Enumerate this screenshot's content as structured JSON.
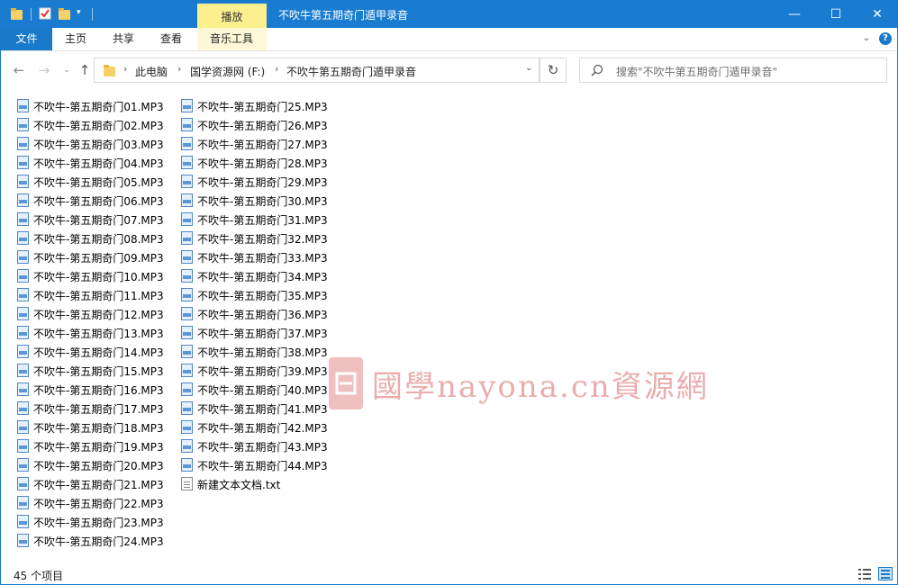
{
  "window": {
    "title": "不吹牛第五期奇门遁甲录音",
    "contextual_tab": "播放",
    "controls": {
      "minimize": "—",
      "maximize": "☐",
      "close": "✕"
    }
  },
  "ribbon": {
    "file_tab": "文件",
    "tabs": [
      "主页",
      "共享",
      "查看",
      "音乐工具"
    ]
  },
  "address": {
    "breadcrumbs": [
      "此电脑",
      "国学资源网 (F:)",
      "不吹牛第五期奇门遁甲录音"
    ],
    "separator": "›"
  },
  "search": {
    "placeholder": "搜索\"不吹牛第五期奇门遁甲录音\""
  },
  "files": [
    {
      "name": "不吹牛-第五期奇门01.MP3",
      "type": "mp3"
    },
    {
      "name": "不吹牛-第五期奇门02.MP3",
      "type": "mp3"
    },
    {
      "name": "不吹牛-第五期奇门03.MP3",
      "type": "mp3"
    },
    {
      "name": "不吹牛-第五期奇门04.MP3",
      "type": "mp3"
    },
    {
      "name": "不吹牛-第五期奇门05.MP3",
      "type": "mp3"
    },
    {
      "name": "不吹牛-第五期奇门06.MP3",
      "type": "mp3"
    },
    {
      "name": "不吹牛-第五期奇门07.MP3",
      "type": "mp3"
    },
    {
      "name": "不吹牛-第五期奇门08.MP3",
      "type": "mp3"
    },
    {
      "name": "不吹牛-第五期奇门09.MP3",
      "type": "mp3"
    },
    {
      "name": "不吹牛-第五期奇门10.MP3",
      "type": "mp3"
    },
    {
      "name": "不吹牛-第五期奇门11.MP3",
      "type": "mp3"
    },
    {
      "name": "不吹牛-第五期奇门12.MP3",
      "type": "mp3"
    },
    {
      "name": "不吹牛-第五期奇门13.MP3",
      "type": "mp3"
    },
    {
      "name": "不吹牛-第五期奇门14.MP3",
      "type": "mp3"
    },
    {
      "name": "不吹牛-第五期奇门15.MP3",
      "type": "mp3"
    },
    {
      "name": "不吹牛-第五期奇门16.MP3",
      "type": "mp3"
    },
    {
      "name": "不吹牛-第五期奇门17.MP3",
      "type": "mp3"
    },
    {
      "name": "不吹牛-第五期奇门18.MP3",
      "type": "mp3"
    },
    {
      "name": "不吹牛-第五期奇门19.MP3",
      "type": "mp3"
    },
    {
      "name": "不吹牛-第五期奇门20.MP3",
      "type": "mp3"
    },
    {
      "name": "不吹牛-第五期奇门21.MP3",
      "type": "mp3"
    },
    {
      "name": "不吹牛-第五期奇门22.MP3",
      "type": "mp3"
    },
    {
      "name": "不吹牛-第五期奇门23.MP3",
      "type": "mp3"
    },
    {
      "name": "不吹牛-第五期奇门24.MP3",
      "type": "mp3"
    },
    {
      "name": "不吹牛-第五期奇门25.MP3",
      "type": "mp3"
    },
    {
      "name": "不吹牛-第五期奇门26.MP3",
      "type": "mp3"
    },
    {
      "name": "不吹牛-第五期奇门27.MP3",
      "type": "mp3"
    },
    {
      "name": "不吹牛-第五期奇门28.MP3",
      "type": "mp3"
    },
    {
      "name": "不吹牛-第五期奇门29.MP3",
      "type": "mp3"
    },
    {
      "name": "不吹牛-第五期奇门30.MP3",
      "type": "mp3"
    },
    {
      "name": "不吹牛-第五期奇门31.MP3",
      "type": "mp3"
    },
    {
      "name": "不吹牛-第五期奇门32.MP3",
      "type": "mp3"
    },
    {
      "name": "不吹牛-第五期奇门33.MP3",
      "type": "mp3"
    },
    {
      "name": "不吹牛-第五期奇门34.MP3",
      "type": "mp3"
    },
    {
      "name": "不吹牛-第五期奇门35.MP3",
      "type": "mp3"
    },
    {
      "name": "不吹牛-第五期奇门36.MP3",
      "type": "mp3"
    },
    {
      "name": "不吹牛-第五期奇门37.MP3",
      "type": "mp3"
    },
    {
      "name": "不吹牛-第五期奇门38.MP3",
      "type": "mp3"
    },
    {
      "name": "不吹牛-第五期奇门39.MP3",
      "type": "mp3"
    },
    {
      "name": "不吹牛-第五期奇门40.MP3",
      "type": "mp3"
    },
    {
      "name": "不吹牛-第五期奇门41.MP3",
      "type": "mp3"
    },
    {
      "name": "不吹牛-第五期奇门42.MP3",
      "type": "mp3"
    },
    {
      "name": "不吹牛-第五期奇门43.MP3",
      "type": "mp3"
    },
    {
      "name": "不吹牛-第五期奇门44.MP3",
      "type": "mp3"
    },
    {
      "name": "新建文本文档.txt",
      "type": "txt"
    }
  ],
  "watermark": {
    "seal": "德",
    "text": "國學nayona.cn資源網"
  },
  "status": {
    "item_count": "45 个项目"
  },
  "colors": {
    "titlebar": "#1a7cd0",
    "contextual_tab": "#fbf08d",
    "file_tab": "#1979ca",
    "watermark": "#d96b6b"
  }
}
